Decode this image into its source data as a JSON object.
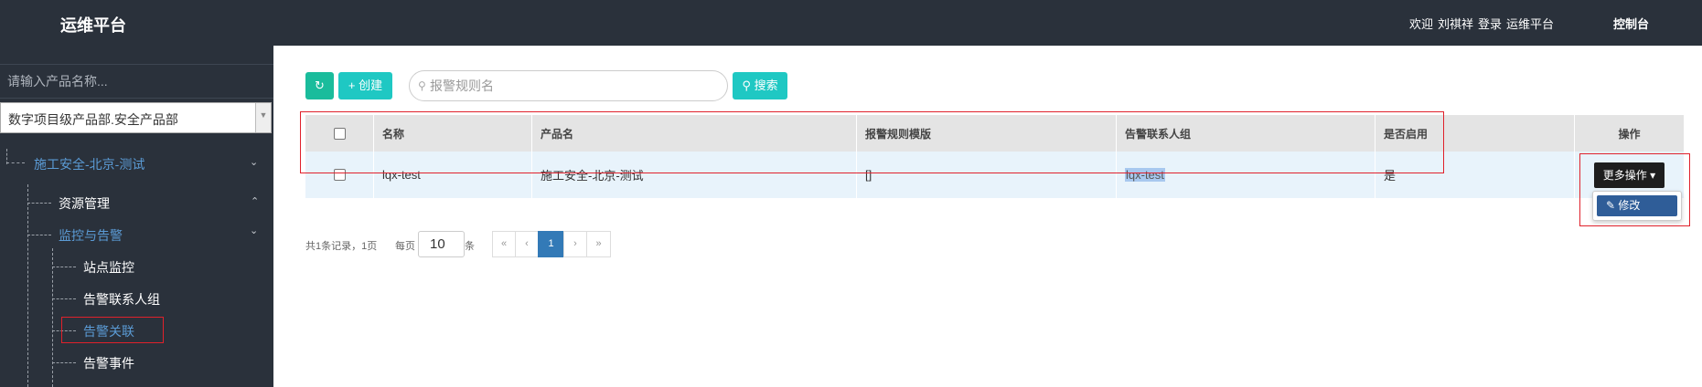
{
  "header": {
    "brand": "运维平台",
    "welcome": "欢迎",
    "user": "刘祺祥",
    "login": "登录",
    "platform": "运维平台",
    "console": "控制台"
  },
  "sidebar": {
    "search_placeholder": "请输入产品名称...",
    "org_select": "数字项目级产品部.安全产品部",
    "tree": {
      "project": "施工安全-北京-测试",
      "resource_mgmt": "资源管理",
      "monitor_alarm": "监控与告警",
      "site_monitor": "站点监控",
      "alarm_contact_group": "告警联系人组",
      "alarm_association": "告警关联",
      "alarm_event": "告警事件"
    }
  },
  "toolbar": {
    "refresh_icon": "refresh-icon",
    "create_label": "创建",
    "search_placeholder": "报警规则名",
    "search_label": "搜索"
  },
  "table": {
    "columns": [
      "名称",
      "产品名",
      "报警规则模版",
      "告警联系人组",
      "是否启用",
      "操作"
    ],
    "rows": [
      {
        "name": "lqx-test",
        "product": "施工安全-北京-测试",
        "rule_template": "[]",
        "contact_group": "lqx-test",
        "enabled": "是"
      }
    ],
    "more_ops_label": "更多操作",
    "edit_label": "修改"
  },
  "pagination": {
    "summary": "共1条记录，1页",
    "per_page_label": "每页",
    "page_size": "10",
    "per_page_unit": "条",
    "first": "«",
    "prev": "‹",
    "current": "1",
    "next": "›",
    "last": "»"
  },
  "colors": {
    "header_bg": "#2a313b",
    "accent_teal": "#1fc8c3",
    "active_link": "#5b9bd5",
    "highlight_red": "#e0212b",
    "primary_blue": "#337ab7"
  }
}
